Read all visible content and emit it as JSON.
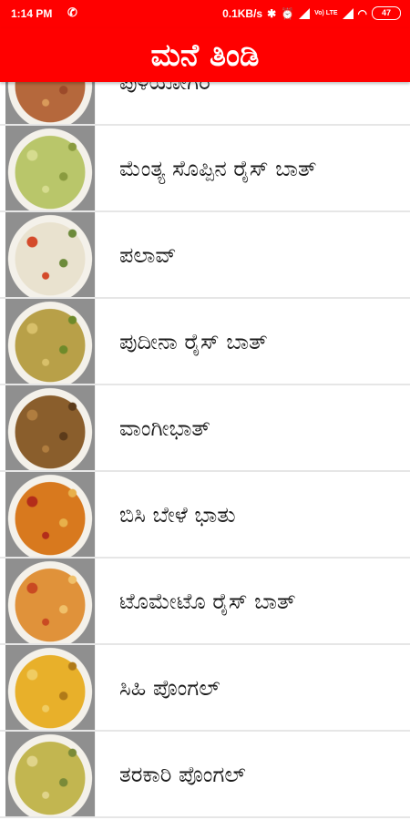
{
  "status_bar": {
    "time": "1:14 PM",
    "network_speed": "0.1KB/s",
    "lte_label": "Vo) LTE",
    "battery": "47",
    "icons": [
      "phone-call-icon",
      "bluetooth-icon",
      "alarm-icon",
      "signal-icon",
      "wifi-icon",
      "battery-icon"
    ]
  },
  "app_bar": {
    "title": "ಮನೆ ತಿಂಡಿ",
    "background": "#ff0000"
  },
  "recipes": [
    {
      "label": "ಪುಳಿಯೋಗರೆ",
      "colors": [
        "#b5683c",
        "#d99a5a",
        "#9c4a2a"
      ]
    },
    {
      "label": "ಮೆಂತ್ಯ ಸೊಪ್ಪಿನ ರೈಸ್ ಬಾತ್",
      "colors": [
        "#b9c66a",
        "#d6dc8f",
        "#8a9b3f"
      ]
    },
    {
      "label": "ಪಲಾವ್",
      "colors": [
        "#e9e2cf",
        "#d44a2a",
        "#6c8a3a"
      ]
    },
    {
      "label": "ಪುದೀನಾ ರೈಸ್ ಬಾತ್",
      "colors": [
        "#b8a048",
        "#d8c06a",
        "#6e8a2a"
      ]
    },
    {
      "label": "ವಾಂಗೀಭಾತ್",
      "colors": [
        "#8a5e2c",
        "#b07d3f",
        "#5c3b1a"
      ]
    },
    {
      "label": "ಬಿಸಿ ಬೇಳೆ ಭಾತು",
      "colors": [
        "#d8791e",
        "#b32d1a",
        "#e8b04a"
      ]
    },
    {
      "label": "ಟೊಮೇಟೊ ರೈಸ್ ಬಾತ್",
      "colors": [
        "#e0923a",
        "#c94a22",
        "#f0c06a"
      ]
    },
    {
      "label": "ಸಿಹಿ ಪೊಂಗಲ್",
      "colors": [
        "#e8b02a",
        "#f0cc62",
        "#b07a18"
      ]
    },
    {
      "label": "ತರಕಾರಿ ಪೊಂಗಲ್",
      "colors": [
        "#c2b650",
        "#e0d48a",
        "#7a8a38"
      ]
    }
  ]
}
